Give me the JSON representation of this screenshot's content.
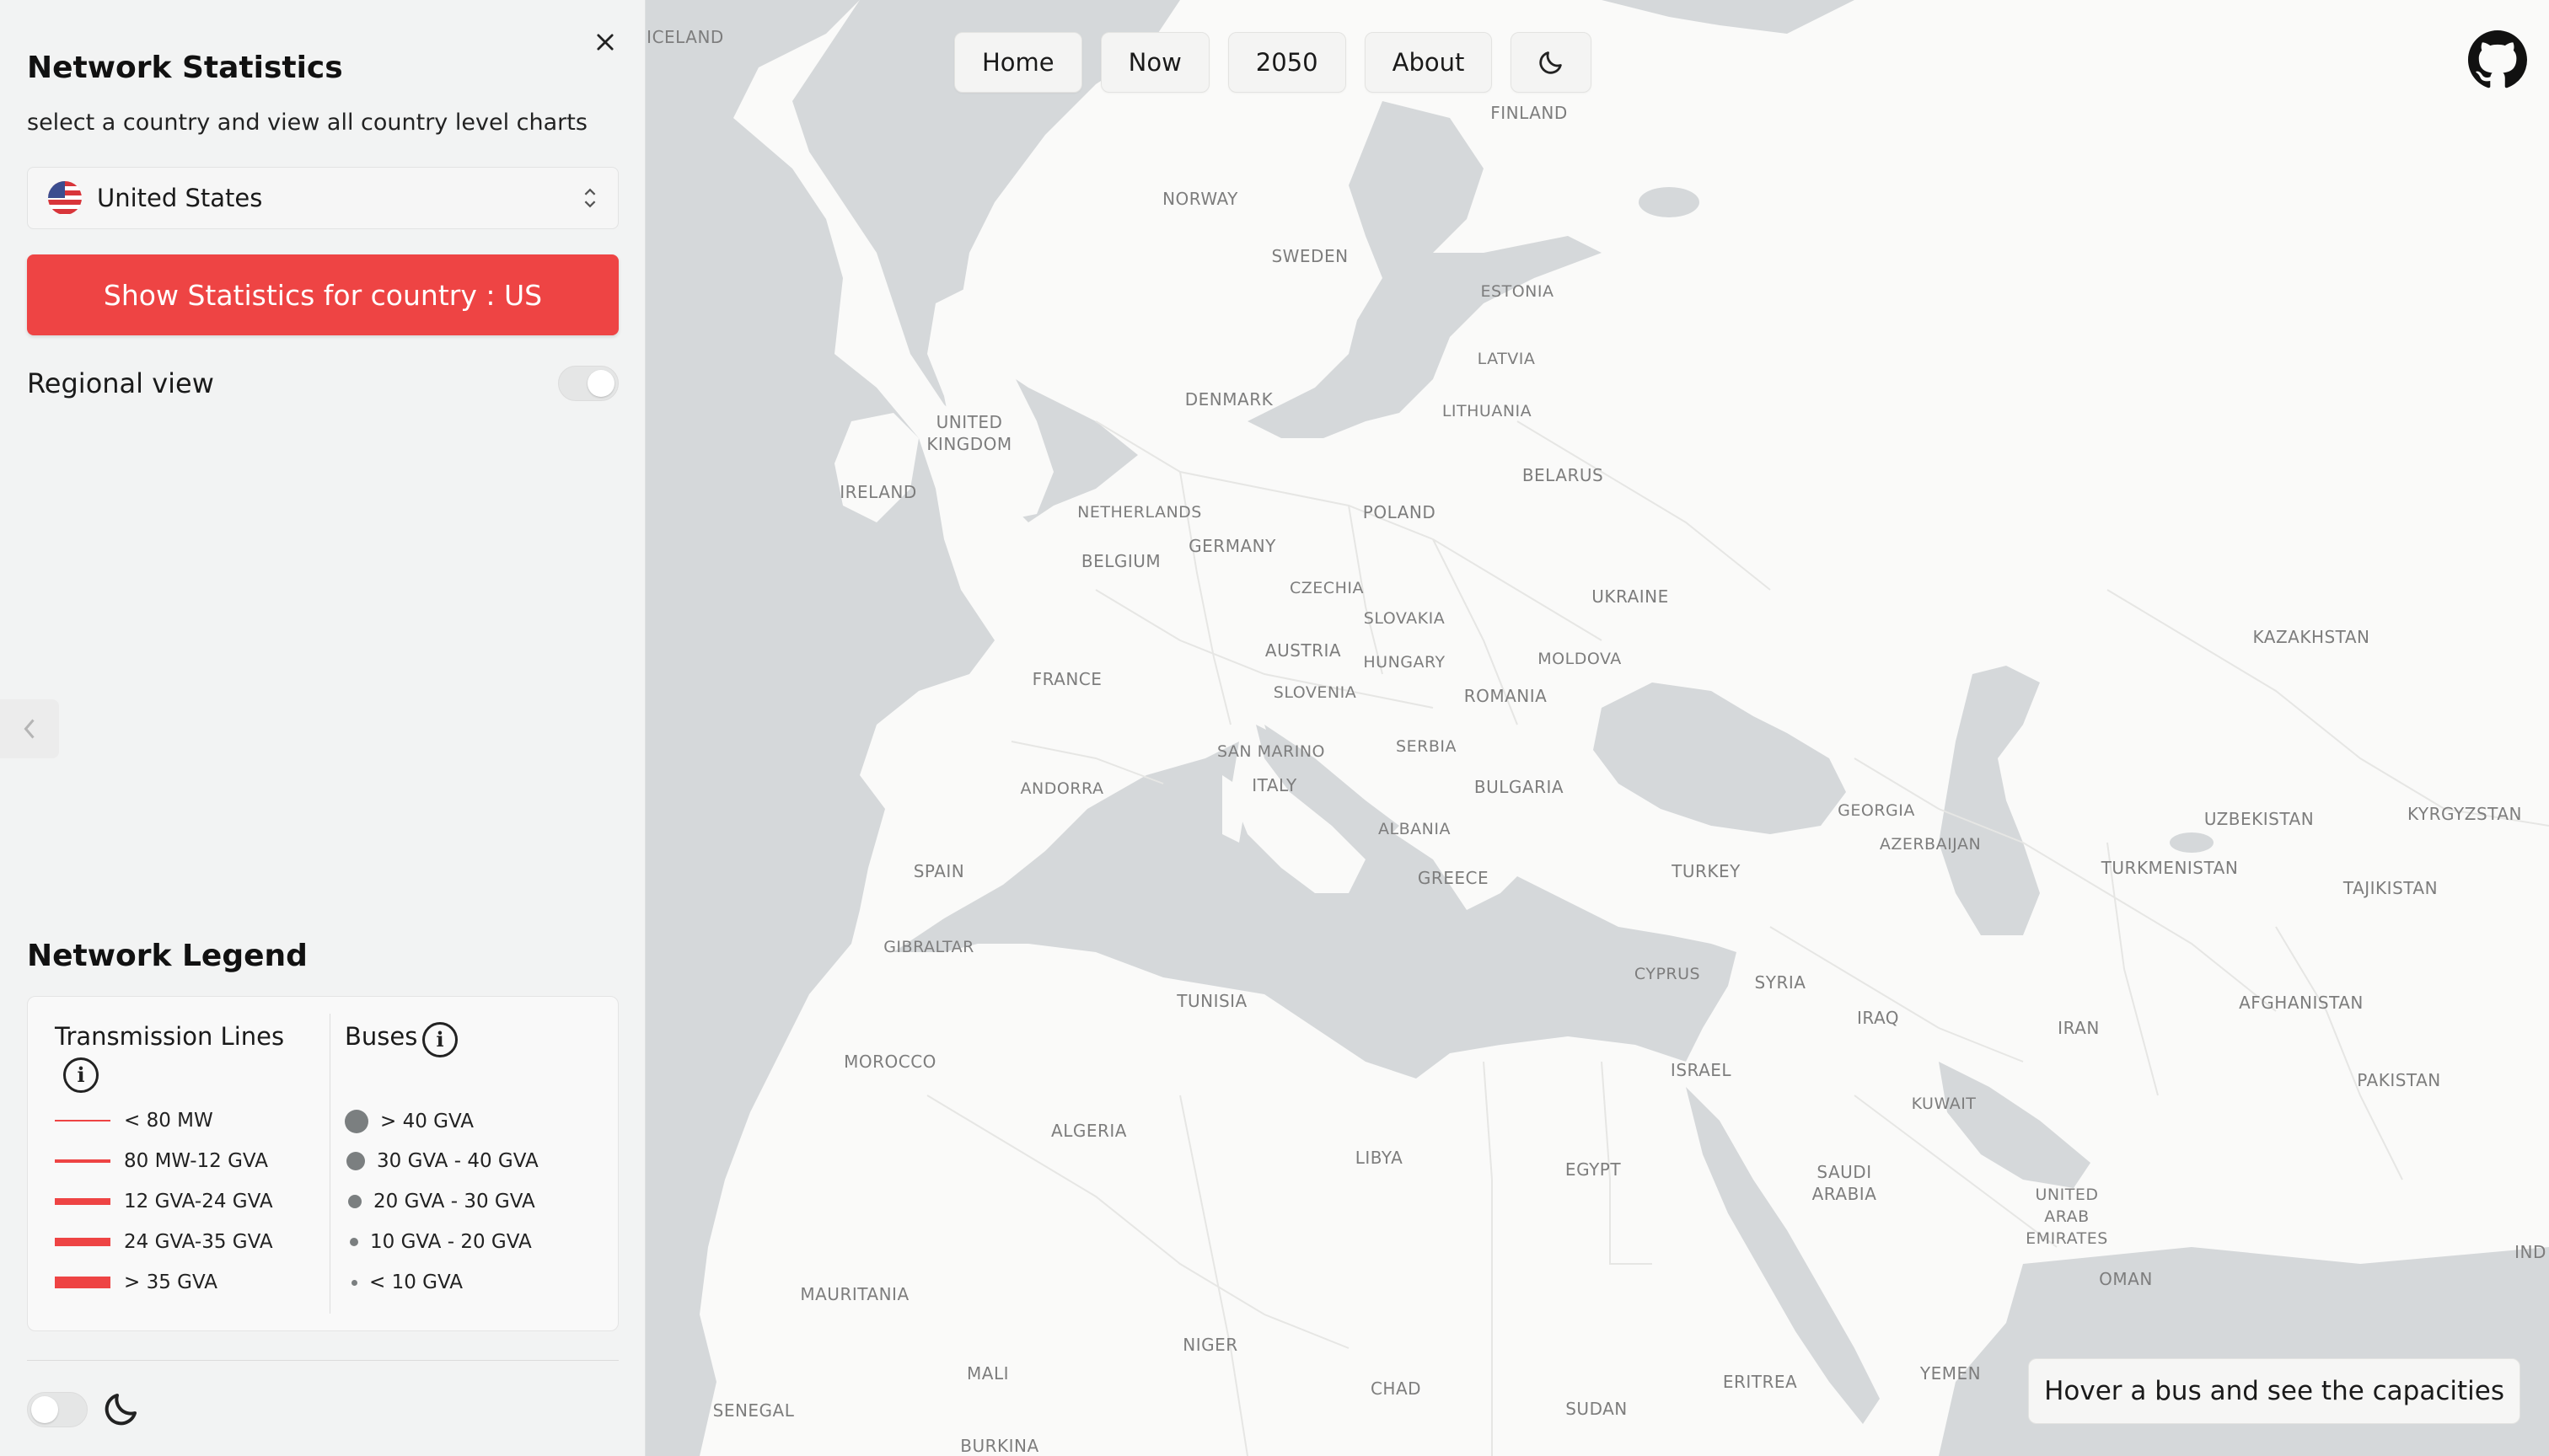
{
  "sidebar": {
    "title": "Network Statistics",
    "subtitle": "select a country and view all country level charts",
    "country_select": {
      "value": "United States",
      "flag_icon": "us-flag-icon"
    },
    "stats_button": "Show Statistics for country : US",
    "regional_view_label": "Regional view",
    "regional_view_on": false,
    "close_icon": "close-icon",
    "collapse_icon": "chevron-left-icon",
    "bottom_theme_icon": "moon-icon"
  },
  "legend": {
    "title": "Network Legend",
    "transmission": {
      "title": "Transmission Lines",
      "items": [
        "< 80 MW",
        "80 MW-12 GVA",
        "12 GVA-24 GVA",
        "24 GVA-35 GVA",
        "> 35 GVA"
      ]
    },
    "buses": {
      "title": "Buses",
      "items": [
        "> 40 GVA",
        "30 GVA - 40 GVA",
        "20 GVA - 30 GVA",
        "10 GVA - 20 GVA",
        "< 10 GVA"
      ]
    }
  },
  "nav": {
    "home": "Home",
    "now": "Now",
    "y2050": "2050",
    "about": "About",
    "theme_icon": "moon-icon"
  },
  "github_icon": "github-icon",
  "hover_hint": "Hover a bus and see the capacities",
  "colors": {
    "accent": "#ee4444",
    "water": "#d5d8da",
    "land": "#fafaf9",
    "bus_dot": "#7b7f80"
  },
  "map": {
    "labels": {
      "iceland": "ICELAND",
      "finland": "FINLAND",
      "norway": "NORWAY",
      "sweden": "SWEDEN",
      "estonia": "ESTONIA",
      "latvia": "LATVIA",
      "denmark": "DENMARK",
      "lithuania": "LITHUANIA",
      "uk": "UNITED\nKINGDOM",
      "ireland": "IRELAND",
      "belarus": "BELARUS",
      "netherlands": "NETHERLANDS",
      "poland": "POLAND",
      "germany": "GERMANY",
      "belgium": "BELGIUM",
      "czechia": "CZECHIA",
      "ukraine": "UKRAINE",
      "slovakia": "SLOVAKIA",
      "austria": "AUSTRIA",
      "hungary": "HUNGARY",
      "moldova": "MOLDOVA",
      "france": "FRANCE",
      "slovenia": "SLOVENIA",
      "romania": "ROMANIA",
      "kazakhstan": "KAZAKHSTAN",
      "san_marino": "SAN MARINO",
      "serbia": "SERBIA",
      "andorra": "ANDORRA",
      "italy": "ITALY",
      "bulgaria": "BULGARIA",
      "georgia": "GEORGIA",
      "uzbekistan": "UZBEKISTAN",
      "kyrgyzstan": "KYRGYZSTAN",
      "albania": "ALBANIA",
      "azerbaijan": "AZERBAIJAN",
      "spain": "SPAIN",
      "turkey": "TURKEY",
      "turkmenistan": "TURKMENISTAN",
      "greece": "GREECE",
      "tajikistan": "TAJIKISTAN",
      "gibraltar": "GIBRALTAR",
      "cyprus": "CYPRUS",
      "syria": "SYRIA",
      "tunisia": "TUNISIA",
      "afghanistan": "AFGHANISTAN",
      "iraq": "IRAQ",
      "iran": "IRAN",
      "morocco": "MOROCCO",
      "israel": "ISRAEL",
      "pakistan": "PAKISTAN",
      "kuwait": "KUWAIT",
      "algeria": "ALGERIA",
      "libya": "LIBYA",
      "egypt": "EGYPT",
      "saudi": "SAUDI\nARABIA",
      "uae": "UNITED\nARAB\nEMIRATES",
      "ind": "IND",
      "oman": "OMAN",
      "mauritania": "MAURITANIA",
      "niger": "NIGER",
      "mali": "MALI",
      "chad": "CHAD",
      "eritrea": "ERITREA",
      "yemen": "YEMEN",
      "senegal": "SENEGAL",
      "sudan": "SUDAN",
      "burkina": "BURKINA"
    }
  }
}
